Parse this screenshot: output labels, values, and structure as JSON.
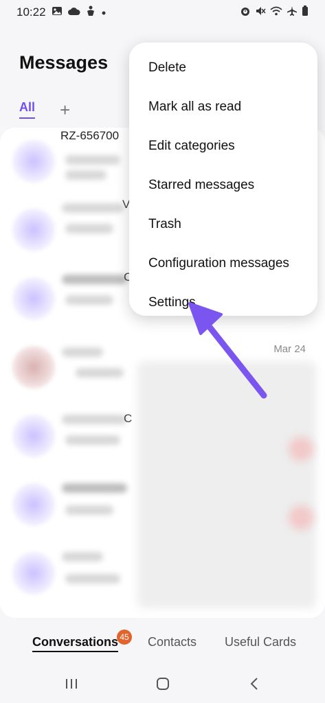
{
  "status_bar": {
    "time": "10:22",
    "left_icons": [
      "gallery-icon",
      "cloud-icon",
      "accessibility-icon",
      "dot-icon"
    ],
    "right_icons": [
      "alarm-icon",
      "mute-icon",
      "wifi-icon",
      "airplane-icon",
      "battery-icon"
    ]
  },
  "header": {
    "title": "Messages"
  },
  "filter_tabs": {
    "all_label": "All",
    "add_label": "+"
  },
  "list": {
    "first_name_visible": "RZ-656700",
    "partial_letters": [
      "V",
      "C",
      "C"
    ],
    "date": "Mar 24"
  },
  "menu": {
    "items": [
      {
        "label": "Delete"
      },
      {
        "label": "Mark all as read"
      },
      {
        "label": "Edit categories"
      },
      {
        "label": "Starred messages"
      },
      {
        "label": "Trash"
      },
      {
        "label": "Configuration messages"
      },
      {
        "label": "Settings"
      }
    ]
  },
  "bottom_tabs": {
    "conversations": "Conversations",
    "badge": "45",
    "contacts": "Contacts",
    "useful_cards": "Useful Cards"
  },
  "colors": {
    "accent": "#6f4ff2",
    "badge": "#e0642d",
    "annotation_arrow": "#7a55f0"
  }
}
